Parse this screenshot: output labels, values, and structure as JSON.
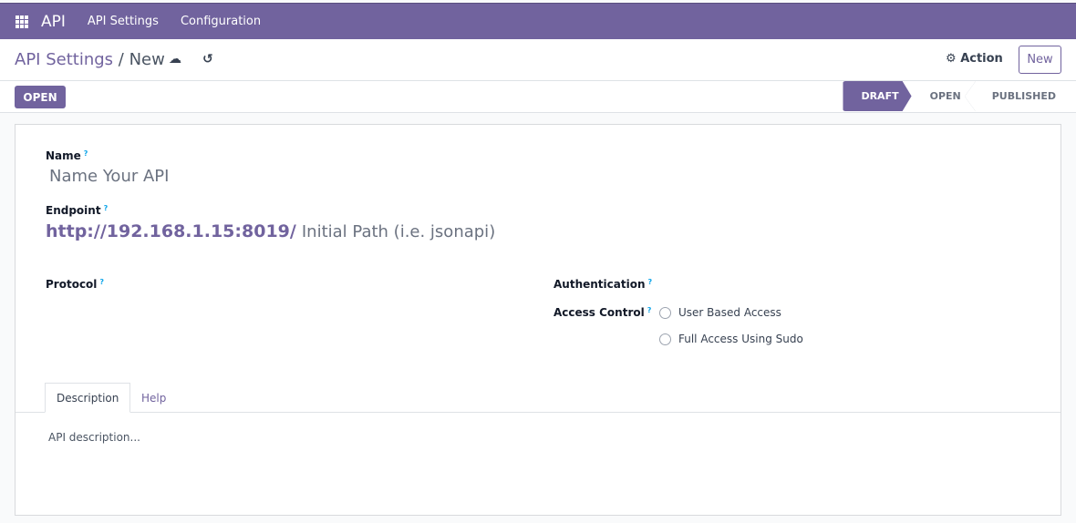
{
  "topbar": {
    "app": "API",
    "menu": [
      "API Settings",
      "Configuration"
    ]
  },
  "breadcrumb": {
    "parent": "API Settings",
    "sep": "/",
    "current": "New"
  },
  "actions": {
    "action": "Action",
    "new": "New",
    "open": "OPEN"
  },
  "status": [
    "DRAFT",
    "OPEN",
    "PUBLISHED"
  ],
  "form": {
    "name_label": "Name",
    "name_placeholder": "Name Your API",
    "endpoint_label": "Endpoint",
    "endpoint_host": "http://192.168.1.15:8019/",
    "endpoint_placeholder": "Initial Path (i.e. jsonapi)",
    "protocol_label": "Protocol",
    "auth_label": "Authentication",
    "access_label": "Access Control",
    "access_options": [
      "User Based Access",
      "Full Access Using Sudo"
    ],
    "help_mark": "?"
  },
  "tabs": [
    "Description",
    "Help"
  ],
  "description_placeholder": "API description...",
  "colors": {
    "brand": "#71639e"
  }
}
